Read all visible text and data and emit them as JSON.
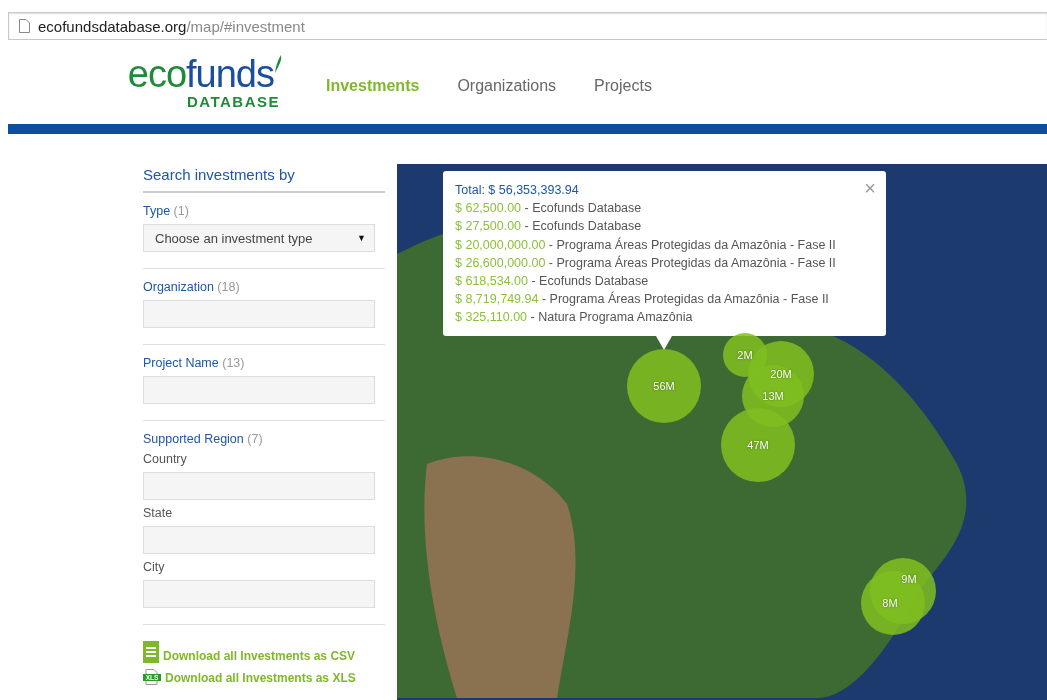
{
  "address_bar": {
    "domain": "ecofundsdatabase.org",
    "path": "/map/#investment"
  },
  "logo": {
    "part_1": "eco",
    "part_2": "funds",
    "subtitle": "DATABASE"
  },
  "nav": [
    {
      "label": "Investments",
      "selected": true
    },
    {
      "label": "Organizations",
      "selected": false
    },
    {
      "label": "Projects",
      "selected": false
    }
  ],
  "sidebar": {
    "title": "Search investments by",
    "filters": [
      {
        "kind": "select",
        "label": "Type",
        "count": "(1)",
        "placeholder": "Choose an investment type",
        "caret": "▼"
      },
      {
        "kind": "text",
        "label": "Organization",
        "count": "(18)"
      },
      {
        "kind": "text",
        "label": "Project Name",
        "count": "(13)"
      },
      {
        "kind": "group",
        "label": "Supported Region",
        "count": "(7)",
        "fields": [
          "Country",
          "State",
          "City"
        ]
      }
    ],
    "downloads": [
      {
        "kind": "csv",
        "label": "Download all Investments as CSV"
      },
      {
        "kind": "xls",
        "label": "Download all Investments as XLS",
        "icon_text": "XLS"
      }
    ]
  },
  "map": {
    "popup": {
      "total": "Total: $ 56,353,393.94",
      "close": "×",
      "entries": [
        {
          "amount": "$ 62,500.00",
          "name": "- Ecofunds Database"
        },
        {
          "amount": "$ 27,500.00",
          "name": "- Ecofunds Database"
        },
        {
          "amount": "$ 20,000,000.00",
          "name": "- Programa Áreas Protegidas da Amazônia - Fase II"
        },
        {
          "amount": "$ 26,600,000.00",
          "name": "- Programa Áreas Protegidas da Amazônia - Fase II"
        },
        {
          "amount": "$ 618,534.00",
          "name": "- Ecofunds Database"
        },
        {
          "amount": "$ 8,719,749.94",
          "name": "- Programa Áreas Protegidas da Amazônia - Fase II"
        },
        {
          "amount": "$ 325,110.00",
          "name": "- Natura Programa Amazônia"
        }
      ]
    },
    "clusters": [
      {
        "label": "56M"
      },
      {
        "label": "2M"
      },
      {
        "label": "20M"
      },
      {
        "label": "13M"
      },
      {
        "label": "47M"
      },
      {
        "label": "9M"
      },
      {
        "label": "8M"
      }
    ]
  }
}
